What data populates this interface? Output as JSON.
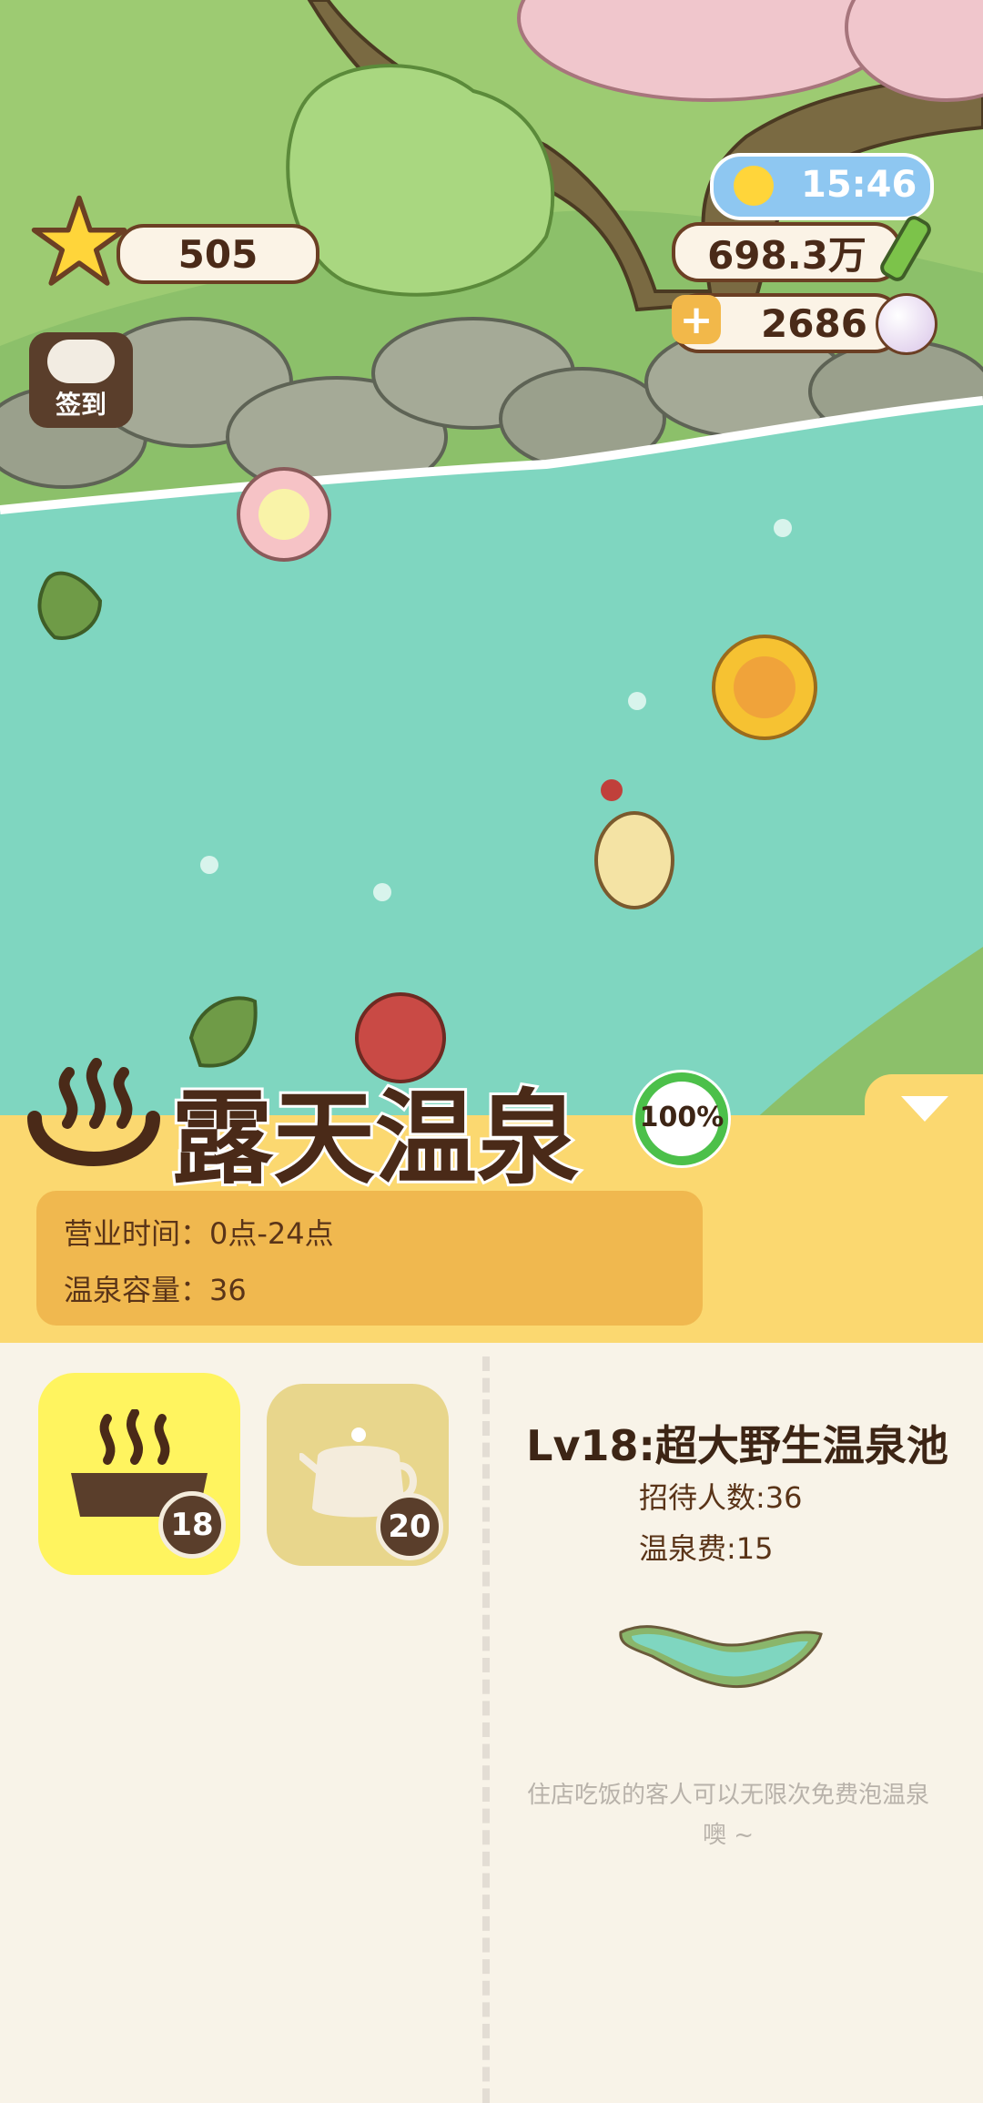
{
  "hud": {
    "stars": "505",
    "time": "15:46",
    "money": "698.3万",
    "pearls": "2686",
    "checkin_label": "签到"
  },
  "area": {
    "title": "露天温泉",
    "progress": "100%",
    "progress_fraction": 1.0,
    "hours_label": "营业时间：",
    "hours_value": "0点-24点",
    "capacity_label": "温泉容量：",
    "capacity_value": "36"
  },
  "upgrades": [
    {
      "name": "hot-spring-pool",
      "level": "18",
      "selected": true
    },
    {
      "name": "teapot",
      "level": "20",
      "selected": false
    }
  ],
  "detail": {
    "title": "Lv18:超大野生温泉池",
    "guests": "招待人数:36",
    "fee": "温泉费:15",
    "note": "住店吃饭的客人可以无限次免费泡温泉噢 ~"
  },
  "colors": {
    "water": "#7fd6c0",
    "grass": "#8cc06a",
    "panel": "#fbd870",
    "brown": "#5a3e2b"
  },
  "icons": [
    "star-icon",
    "sun-icon",
    "bamboo-icon",
    "plus-icon",
    "pearl-icon",
    "panda-icon",
    "hot-spring-icon",
    "collapse-arrow-icon",
    "teapot-icon"
  ]
}
